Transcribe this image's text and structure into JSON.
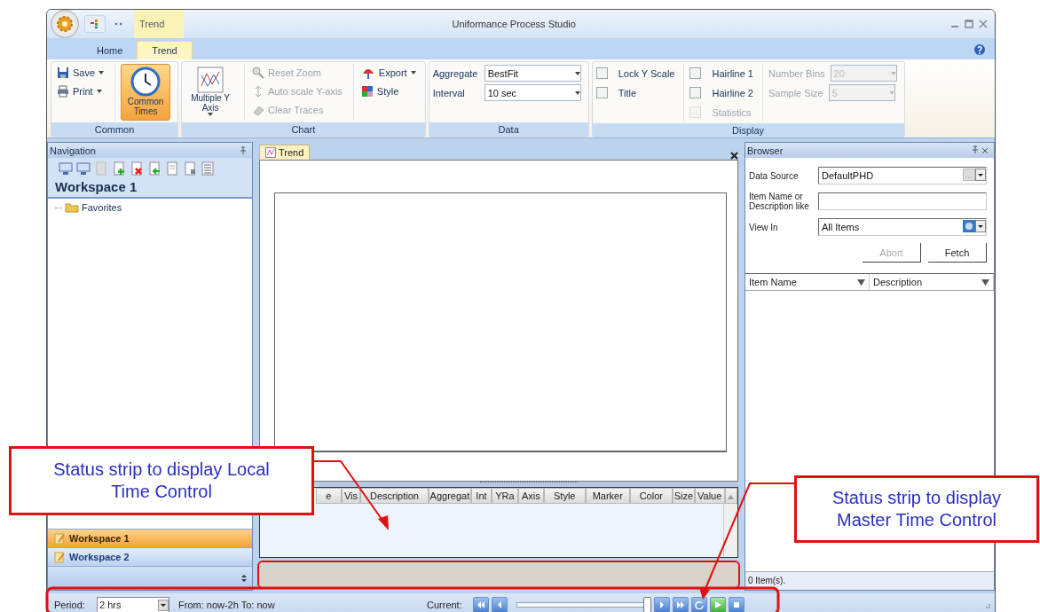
{
  "window": {
    "title": "Uniformance Process Studio",
    "context_tab": "Trend"
  },
  "ribbon_tabs": [
    {
      "label": "Home",
      "selected": false
    },
    {
      "label": "Trend",
      "selected": true
    }
  ],
  "ribbon_groups": [
    {
      "label": "Common",
      "columns": [
        [
          {
            "kind": "small",
            "label": "Save",
            "dropdown": true,
            "disabled": false
          },
          {
            "kind": "small",
            "label": "Print",
            "dropdown": true,
            "disabled": false
          }
        ],
        [
          {
            "kind": "large",
            "label": "Common Times",
            "dropdown": false,
            "selected": true
          }
        ]
      ]
    },
    {
      "label": "Chart",
      "columns": [
        [
          {
            "kind": "large",
            "label": "Multiple Y Axis",
            "dropdown": true,
            "selected": false
          }
        ],
        [
          {
            "kind": "small",
            "label": "Reset Zoom",
            "dropdown": false,
            "disabled": true
          },
          {
            "kind": "small",
            "label": "Auto scale Y-axis",
            "dropdown": false,
            "disabled": true
          },
          {
            "kind": "small",
            "label": "Clear Traces",
            "dropdown": false,
            "disabled": true
          }
        ],
        [
          {
            "kind": "small",
            "label": "Export",
            "dropdown": true,
            "disabled": false
          },
          {
            "kind": "small",
            "label": "Style",
            "dropdown": false,
            "disabled": false
          }
        ]
      ]
    },
    {
      "label": "Data",
      "columns": [
        [
          {
            "kind": "combo",
            "label": "Aggregate",
            "value": "BestFit",
            "disabled": false
          },
          {
            "kind": "combo",
            "label": "Interval",
            "value": "10 sec",
            "disabled": false
          }
        ]
      ]
    },
    {
      "label": "Display",
      "columns": [
        [
          {
            "kind": "checkbox",
            "label": "Lock Y Scale",
            "checked": false,
            "disabled": false
          },
          {
            "kind": "checkbox",
            "label": "Title",
            "checked": false,
            "disabled": false
          }
        ],
        [
          {
            "kind": "checkbox",
            "label": "Hairline 1",
            "checked": false,
            "disabled": false
          },
          {
            "kind": "checkbox",
            "label": "Hairline 2",
            "checked": false,
            "disabled": false
          },
          {
            "kind": "checkbox",
            "label": "Statistics",
            "checked": false,
            "disabled": true
          }
        ],
        [
          {
            "kind": "combo",
            "label": "Number Bins",
            "value": "20",
            "disabled": true
          },
          {
            "kind": "combo",
            "label": "Sample Size",
            "value": "5",
            "disabled": true
          }
        ]
      ]
    }
  ],
  "navigation": {
    "title": "Navigation",
    "workspace": "Workspace 1",
    "tree": [
      {
        "label": "Favorites"
      }
    ],
    "workspaces": [
      {
        "label": "Workspace 1",
        "selected": true
      },
      {
        "label": "Workspace 2",
        "selected": false
      }
    ]
  },
  "document": {
    "tab": "Trend",
    "trace_columns": [
      "e",
      "Vis",
      "Description",
      "Aggregat",
      "Int",
      "YRa",
      "Axis",
      "Style",
      "Marker",
      "Color",
      "Size",
      "Value"
    ]
  },
  "browser": {
    "title": "Browser",
    "fields": [
      {
        "kind": "combo",
        "label": "Data Source",
        "value": "DefaultPHD"
      },
      {
        "kind": "text",
        "label": "Item Name or Description like"
      },
      {
        "kind": "combo",
        "label": "View In",
        "value": "All Items"
      }
    ],
    "buttons": [
      {
        "label": "Abort",
        "disabled": true
      },
      {
        "label": "Fetch",
        "disabled": false
      }
    ],
    "columns": [
      "Item Name",
      "Description"
    ],
    "status": "0 Item(s)."
  },
  "status_bar": {
    "period_label": "Period:",
    "period": "2 hrs",
    "range": "From: now-2h To: now",
    "current_label": "Current:",
    "level": 0.97
  },
  "callouts": [
    {
      "text": "Status strip to display Local Time Control"
    },
    {
      "text": "Status strip to display Master Time Control"
    }
  ]
}
